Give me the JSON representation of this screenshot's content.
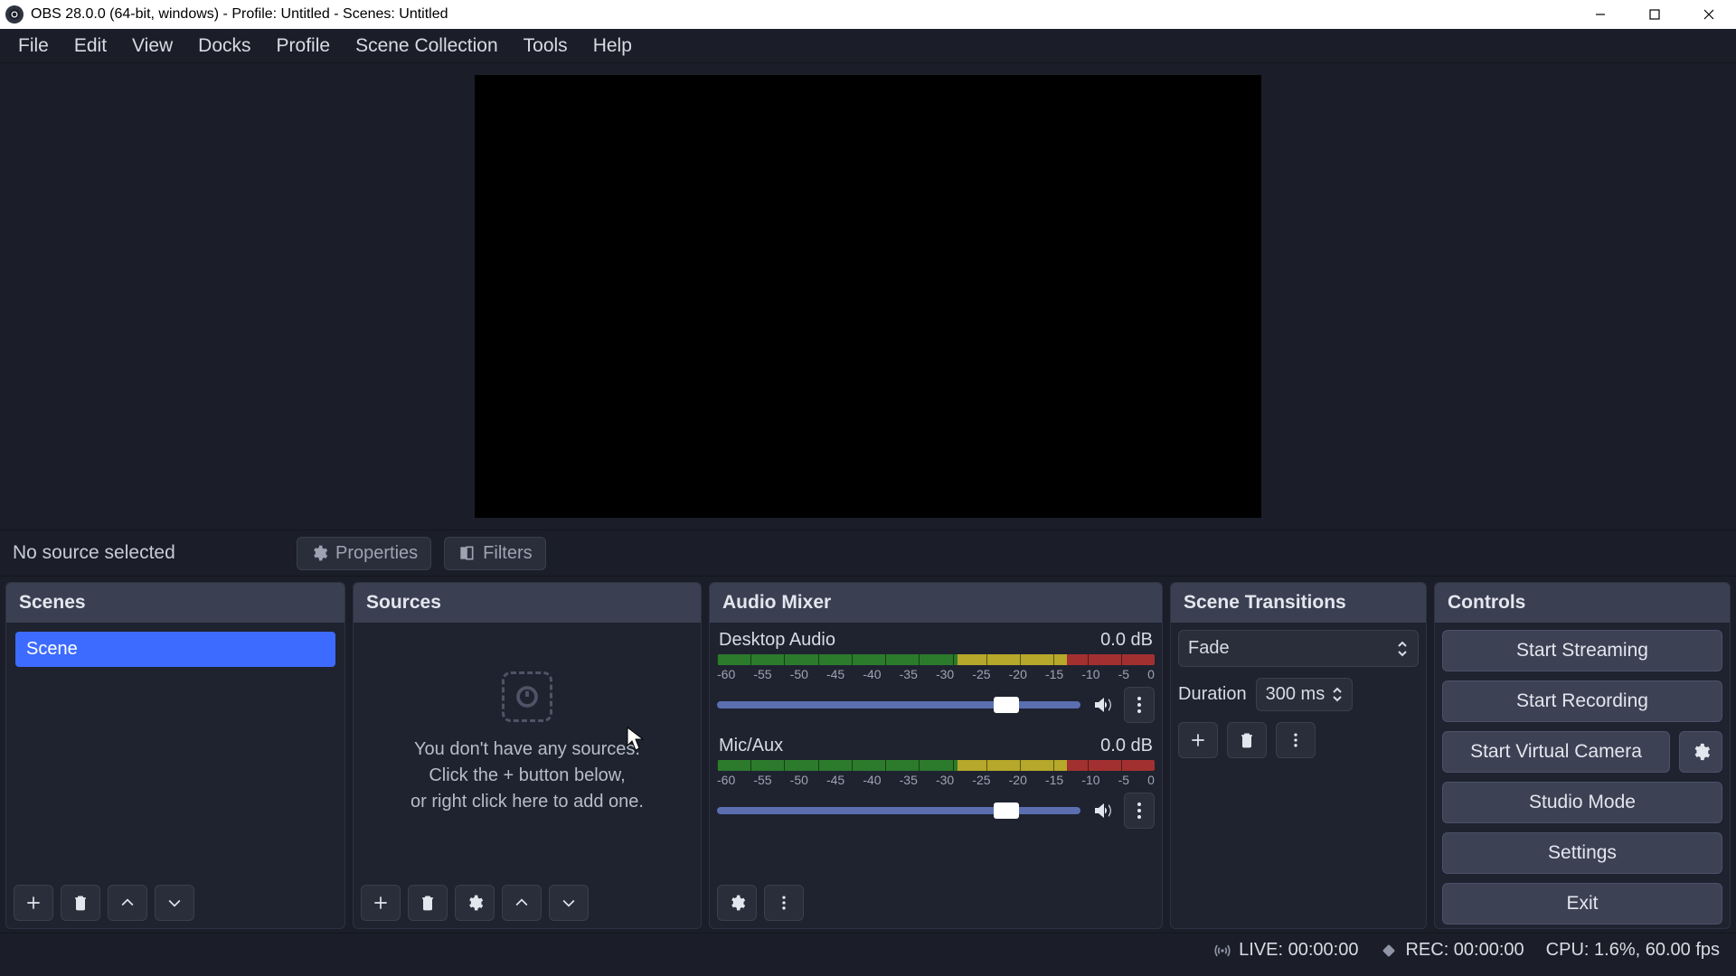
{
  "titlebar": {
    "text": "OBS 28.0.0 (64-bit, windows) - Profile: Untitled - Scenes: Untitled"
  },
  "menubar": [
    "File",
    "Edit",
    "View",
    "Docks",
    "Profile",
    "Scene Collection",
    "Tools",
    "Help"
  ],
  "ctx": {
    "status": "No source selected",
    "properties": "Properties",
    "filters": "Filters"
  },
  "scenes": {
    "title": "Scenes",
    "items": [
      "Scene"
    ]
  },
  "sources": {
    "title": "Sources",
    "empty_l1": "You don't have any sources.",
    "empty_l2": "Click the + button below,",
    "empty_l3": "or right click here to add one."
  },
  "mixer": {
    "title": "Audio Mixer",
    "ticks": [
      "-60",
      "-55",
      "-50",
      "-45",
      "-40",
      "-35",
      "-30",
      "-25",
      "-20",
      "-15",
      "-10",
      "-5",
      "0"
    ],
    "channels": [
      {
        "name": "Desktop Audio",
        "db": "0.0 dB",
        "slider_pct": 76
      },
      {
        "name": "Mic/Aux",
        "db": "0.0 dB",
        "slider_pct": 76
      }
    ]
  },
  "transitions": {
    "title": "Scene Transitions",
    "selected": "Fade",
    "duration_label": "Duration",
    "duration_value": "300 ms"
  },
  "controls": {
    "title": "Controls",
    "buttons": {
      "streaming": "Start Streaming",
      "recording": "Start Recording",
      "virtualcam": "Start Virtual Camera",
      "studio": "Studio Mode",
      "settings": "Settings",
      "exit": "Exit"
    }
  },
  "statusbar": {
    "live": "LIVE: 00:00:00",
    "rec": "REC: 00:00:00",
    "cpu": "CPU: 1.6%, 60.00 fps"
  }
}
